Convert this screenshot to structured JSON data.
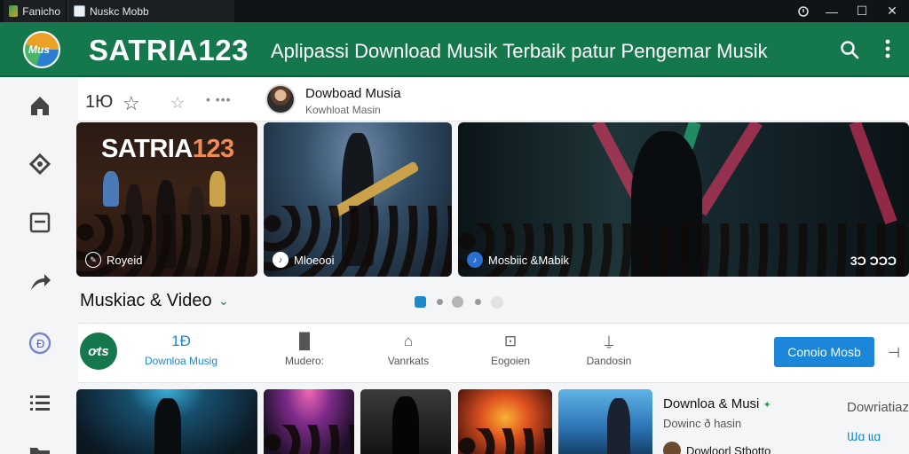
{
  "window": {
    "tab1_title": "Fanicho",
    "tab2_title": "Nuskc Mobb",
    "controls": [
      "search-icon",
      "minimize-icon",
      "maximize-icon",
      "close-icon"
    ]
  },
  "header": {
    "logo_text": "Mus",
    "brand": "SATRIA123",
    "tagline": "Aplipassi Download Musik Terbaik patur Pengemar Musik",
    "accent_color": "#14784c"
  },
  "sidebar": {
    "items": [
      "home-icon",
      "explore-icon",
      "library-icon",
      "share-icon",
      "coin-icon",
      "list-icon",
      "folder-icon"
    ]
  },
  "toolbar": {
    "number": "1Ю",
    "dots": "• •••",
    "profile_title": "Dowboad Musia",
    "profile_subtitle": "Kowhloat Masin"
  },
  "banners": [
    {
      "title_main": "SATRIA",
      "title_accent": "123",
      "caption": "Royeid"
    },
    {
      "caption": "Mloeooi"
    },
    {
      "caption": "Mosbiic &Mabik",
      "count": "3Ɔ ƆƆƆ"
    }
  ],
  "section": {
    "title": "Muskiac & Video",
    "pagination_active": 0
  },
  "nav_tabs": {
    "avatar_text": "ơts",
    "items": [
      {
        "label": "Downloa Musig",
        "icon": "1Ð",
        "active": true
      },
      {
        "label": "Mudero:",
        "icon": "▐▌",
        "active": false
      },
      {
        "label": "Vanrkats",
        "icon": "⌂",
        "active": false
      },
      {
        "label": "Eogoien",
        "icon": "⊡",
        "active": false
      },
      {
        "label": "Dandosin",
        "icon": "⍊",
        "active": false
      }
    ],
    "cta_label": "Conoio Mosb"
  },
  "side_card": {
    "title": "Downloa & Musi",
    "subtitle": "Dowinc ð hasin",
    "user": "Dowloorl Stbotto",
    "right_label": "Dowriatiaz",
    "right_sub": "Ɯɑ ɩɩɑ"
  }
}
